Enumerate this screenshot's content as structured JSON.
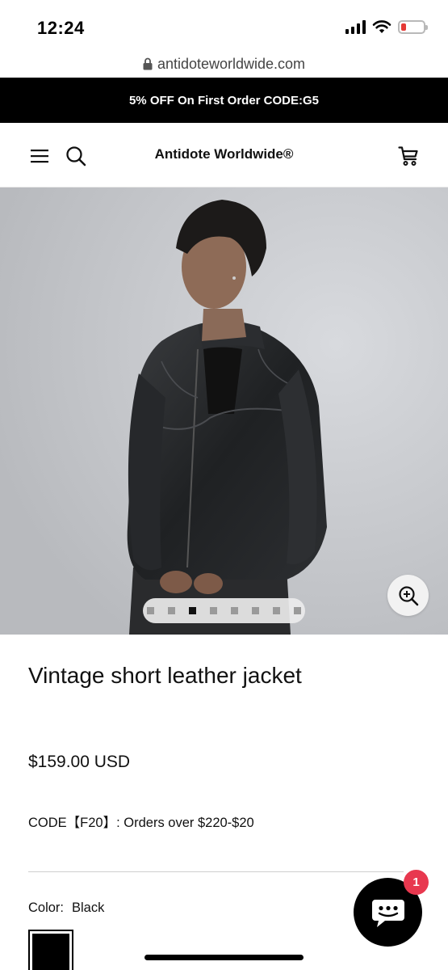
{
  "status_bar": {
    "time": "12:24"
  },
  "browser": {
    "url": "antidoteworldwide.com"
  },
  "announcement": {
    "text": "5% OFF On First Order CODE:G5"
  },
  "header": {
    "logo": "Antidote Worldwide®"
  },
  "icons": {
    "lock": "lock-icon",
    "menu": "menu-icon",
    "search": "search-icon",
    "cart": "cart-icon",
    "zoom": "zoom-in-icon",
    "chat": "chat-icon"
  },
  "gallery": {
    "image_count": 8,
    "active_index": 2
  },
  "product": {
    "title": "Vintage short leather jacket",
    "price": "$159.00 USD",
    "promo": "CODE【F20】: Orders over $220-$20",
    "color_label": "Color:",
    "color_value": "Black"
  },
  "chat": {
    "badge_count": "1"
  },
  "colors": {
    "announcement_bg": "#000000",
    "badge": "#e8384f",
    "battery_low": "#e53935",
    "swatch_black": "#000000"
  }
}
